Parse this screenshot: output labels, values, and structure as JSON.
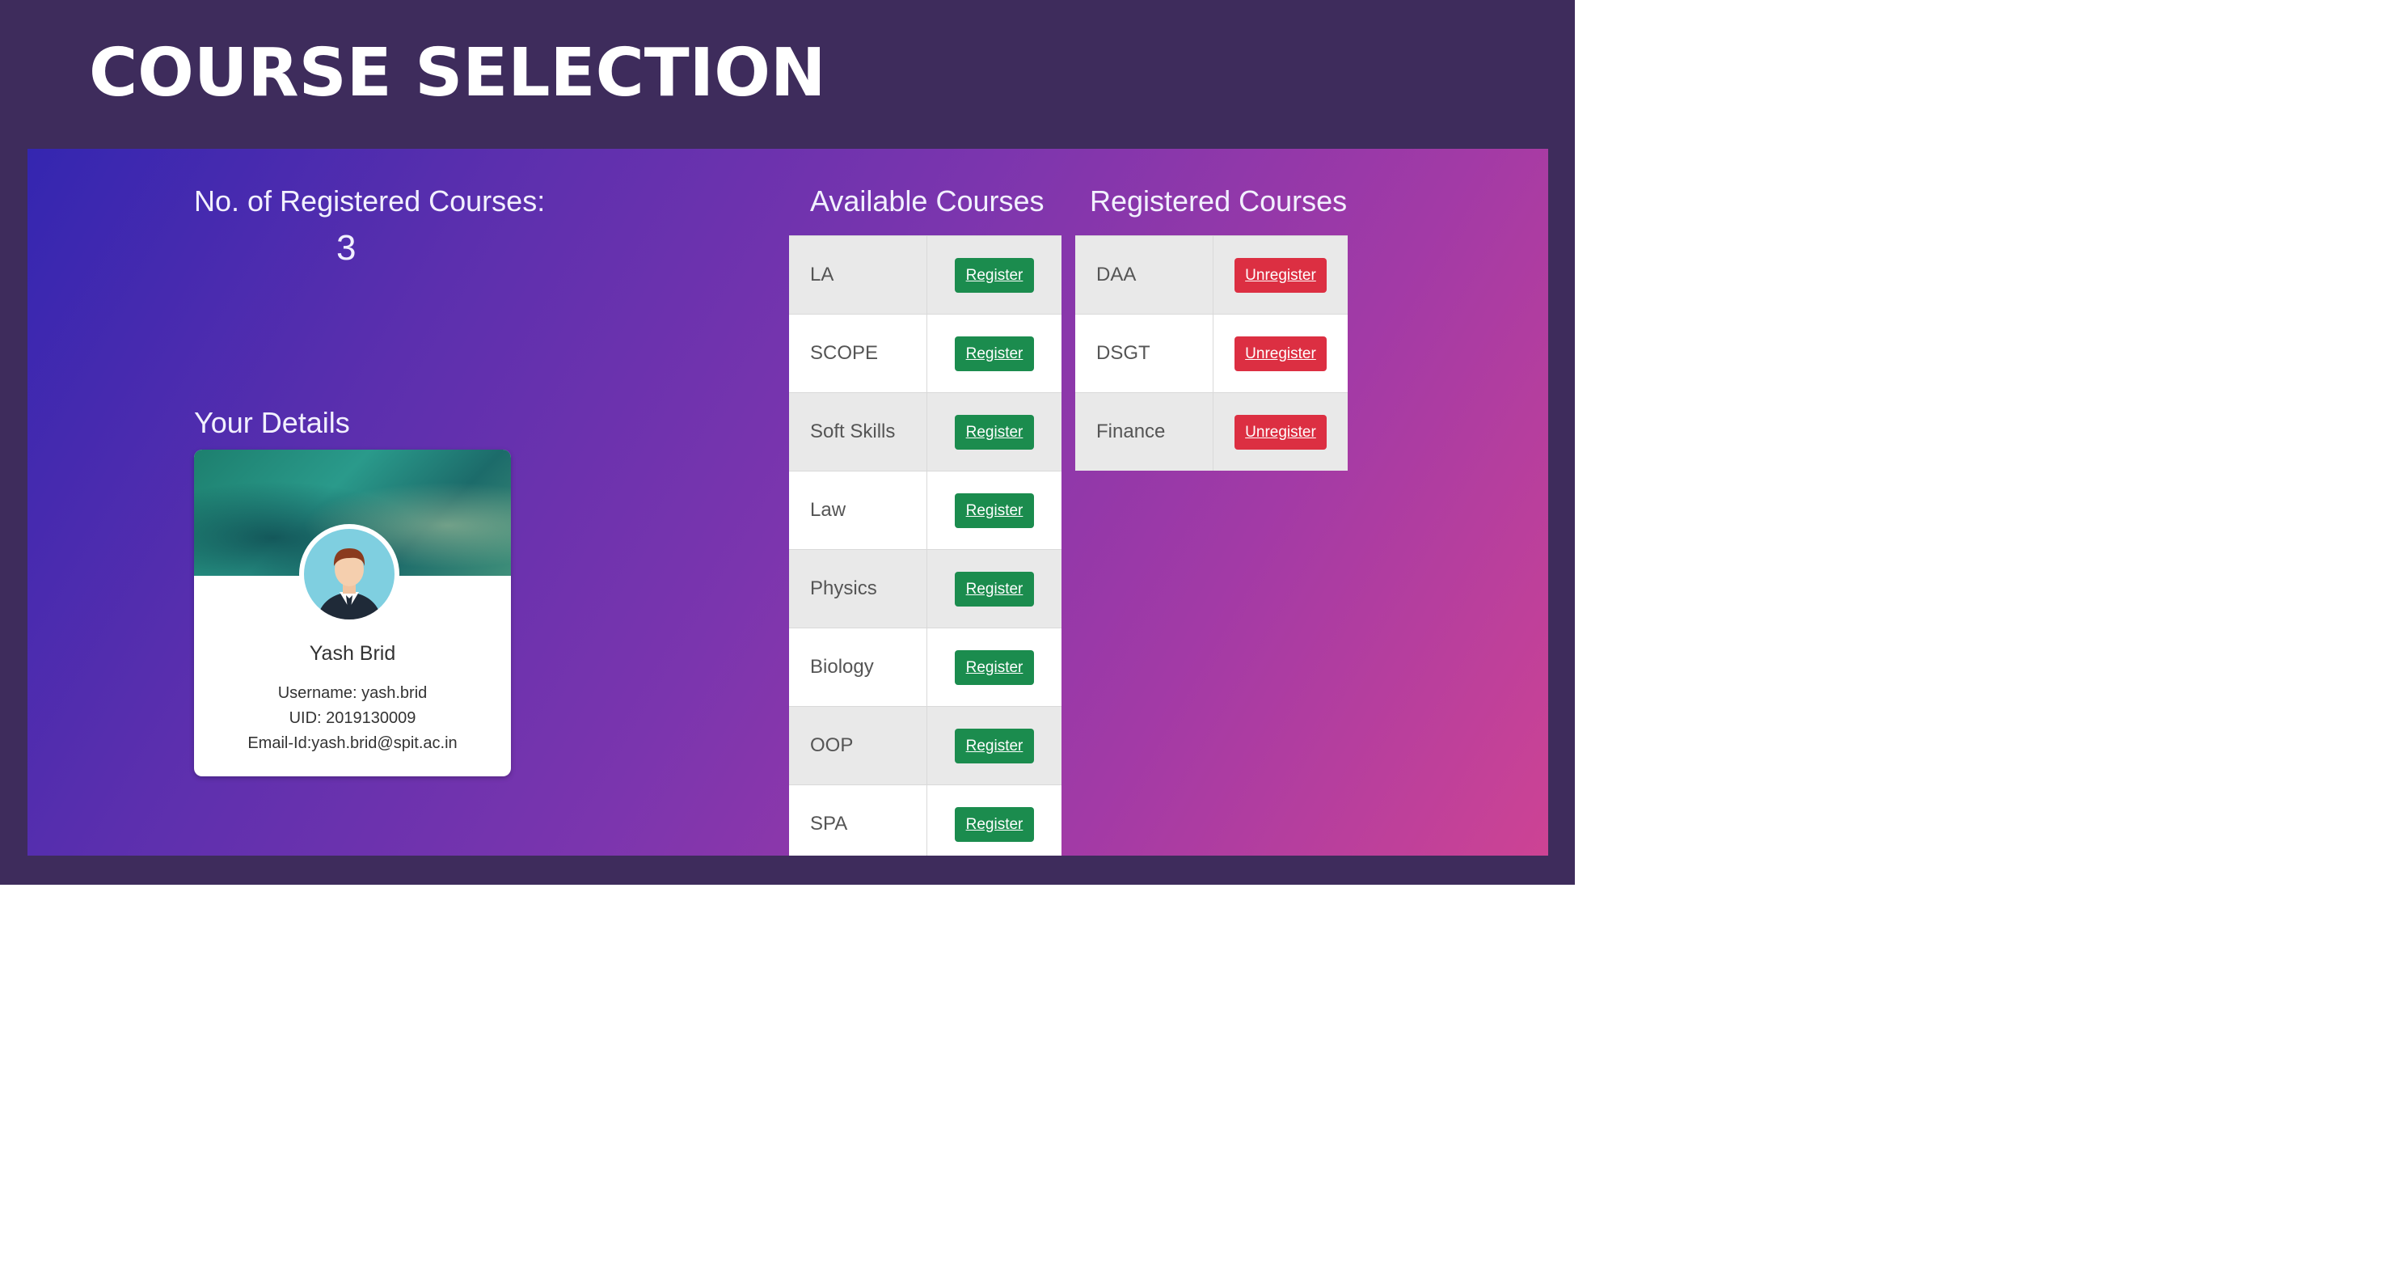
{
  "slide_title": "COURSE SELECTION",
  "registered_count": {
    "label": "No. of Registered Courses:",
    "value": "3"
  },
  "details": {
    "heading": "Your Details",
    "name": "Yash Brid",
    "username": "Username: yash.brid",
    "uid": "UID: 2019130009",
    "email": "Email-Id:yash.brid@spit.ac.in"
  },
  "available": {
    "heading": "Available Courses",
    "button_label": "Register",
    "courses": [
      "LA",
      "SCOPE",
      "Soft Skills",
      "Law",
      "Physics",
      "Biology",
      "OOP",
      "SPA"
    ]
  },
  "registered": {
    "heading": "Registered Courses",
    "button_label": "Unregister",
    "courses": [
      "DAA",
      "DSGT",
      "Finance"
    ]
  },
  "colors": {
    "slide_bg": "#3e2c5c",
    "register_button": "#1b8c4e",
    "unregister_button": "#dc2f42"
  }
}
